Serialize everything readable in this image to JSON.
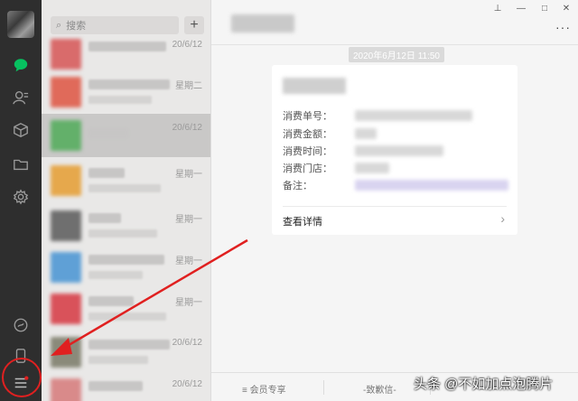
{
  "search": {
    "placeholder": "搜索"
  },
  "add_button": "+",
  "chat_list": [
    {
      "time": "20/6/12",
      "thumb": "#d96b6b"
    },
    {
      "time": "星期二",
      "thumb": "#e06a5a"
    },
    {
      "time": "20/6/12",
      "thumb": "#63b06a"
    },
    {
      "time": "星期一",
      "thumb": "#e6a84c"
    },
    {
      "time": "星期一",
      "thumb": "#6f6f6f"
    },
    {
      "time": "星期一",
      "thumb": "#5fa0d6"
    },
    {
      "time": "星期一",
      "thumb": "#d9525a"
    },
    {
      "time": "20/6/12",
      "thumb": "#8a8a7a"
    },
    {
      "time": "20/6/12",
      "thumb": "#d98a8a"
    }
  ],
  "chat": {
    "timestamp": "2020年6月12日 11:50",
    "card": {
      "fields": [
        "消费单号：",
        "消费金额：",
        "消费时间：",
        "消费门店：",
        "备注："
      ],
      "detail_label": "查看详情",
      "chevron": "›"
    },
    "toolbar": {
      "left": "会员专享",
      "right": "致歉信"
    }
  },
  "watermark": "头条 @不如加点泡腾片",
  "window_controls": [
    "⊥",
    "—",
    "□",
    "✕"
  ],
  "colors": {
    "rail": "#2e2e2e",
    "accent": "#07c160",
    "annotation": "#e02020"
  }
}
